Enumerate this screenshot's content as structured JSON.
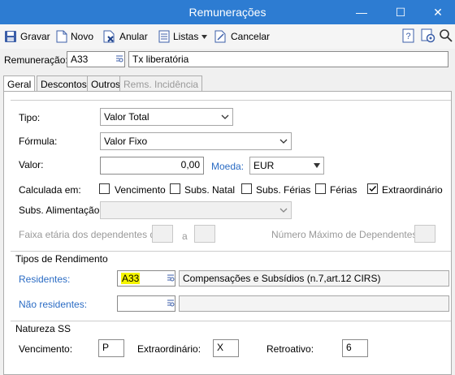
{
  "window": {
    "title": "Remunerações",
    "minimize": "—",
    "maximize": "☐",
    "close": "✕"
  },
  "toolbar": {
    "save": "Gravar",
    "new": "Novo",
    "cancel_doc": "Anular",
    "lists": "Listas",
    "cancel": "Cancelar",
    "icons": [
      "save-icon",
      "new-icon",
      "void-icon",
      "lists-icon",
      "cancel-icon",
      "help-icon",
      "settings-icon",
      "search-icon"
    ]
  },
  "header": {
    "label": "Remuneração:",
    "code": "A33",
    "description": "Tx liberatória"
  },
  "tabs": [
    "Geral",
    "Descontos",
    "Outros",
    "Rems. Incidência"
  ],
  "geral": {
    "tipo_label": "Tipo:",
    "tipo_value": "Valor Total",
    "formula_label": "Fórmula:",
    "formula_value": "Valor Fixo",
    "valor_label": "Valor:",
    "valor_value": "0,00",
    "moeda_label": "Moeda:",
    "moeda_value": "EUR",
    "calculada_label": "Calculada em:",
    "checks": [
      {
        "label": "Vencimento",
        "checked": false
      },
      {
        "label": "Subs. Natal",
        "checked": false
      },
      {
        "label": "Subs. Férias",
        "checked": false
      },
      {
        "label": "Férias",
        "checked": false
      },
      {
        "label": "Extraordinário",
        "checked": true
      }
    ],
    "subs_alim_label": "Subs. Alimentação:",
    "subs_alim_value": "",
    "faixa_label": "Faixa etária dos dependentes de",
    "faixa_a": "a",
    "max_dep_label": "Número Máximo de Dependentes"
  },
  "rendimento": {
    "title": "Tipos de Rendimento",
    "residentes_label": "Residentes:",
    "residentes_code": "A33",
    "residentes_desc": "Compensações e Subsídios (n.7,art.12 CIRS)",
    "nao_residentes_label": "Não residentes:",
    "nao_residentes_code": "",
    "nao_residentes_desc": ""
  },
  "natureza": {
    "title": "Natureza SS",
    "vencimento_label": "Vencimento:",
    "vencimento_value": "P",
    "extra_label": "Extraordinário:",
    "extra_value": "X",
    "retro_label": "Retroativo:",
    "retro_value": "6"
  },
  "colors": {
    "titlebar": "#2d7cd2",
    "link": "#2b6cc4",
    "highlight": "#f5f500"
  }
}
